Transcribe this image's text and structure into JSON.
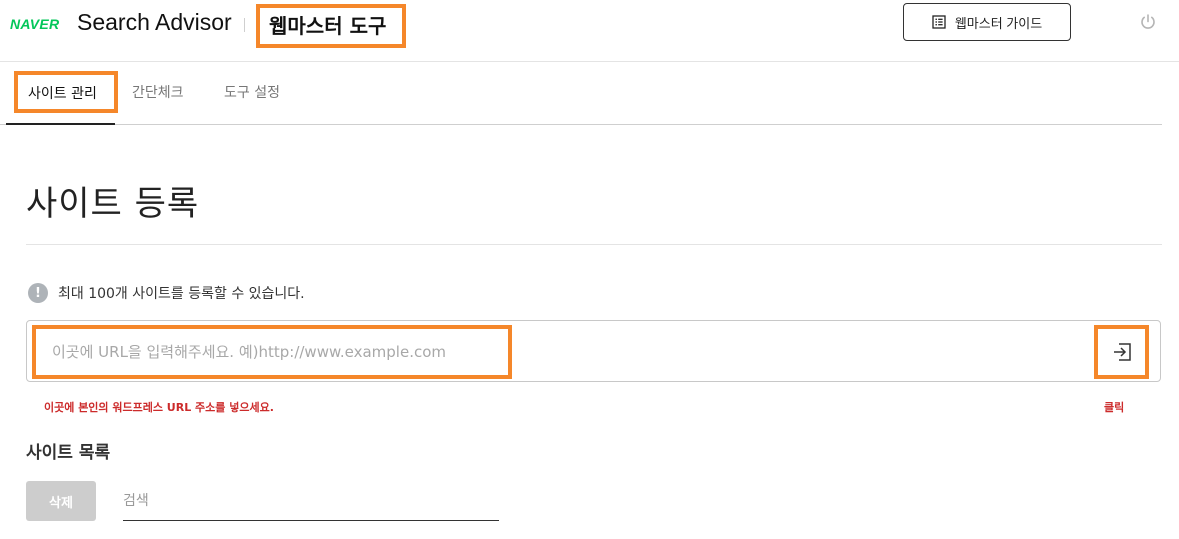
{
  "header": {
    "logo": "NAVER",
    "product_name": "Search Advisor",
    "tool_title": "웹마스터 도구",
    "guide_button": "웹마스터 가이드",
    "guide_icon": "list-icon",
    "logout_icon": "power-icon"
  },
  "tabs": [
    {
      "label": "사이트 관리",
      "active": true
    },
    {
      "label": "간단체크",
      "active": false
    },
    {
      "label": "도구 설정",
      "active": false
    }
  ],
  "main": {
    "title": "사이트 등록",
    "notice": "최대 100개 사이트를 등록할 수 있습니다.",
    "notice_icon": "!",
    "url_placeholder": "이곳에 URL을 입력해주세요. 예)http://www.example.com",
    "submit_icon": "enter-icon",
    "annotation_input": "이곳에 본인의 워드프레스 URL 주소를 넣으세요.",
    "annotation_button": "클릭",
    "list_title": "사이트 목록",
    "delete_button": "삭제",
    "search_placeholder": "검색"
  },
  "colors": {
    "brand": "#03c75a",
    "highlight": "#f5872a",
    "annotation": "#cc2b2b"
  }
}
